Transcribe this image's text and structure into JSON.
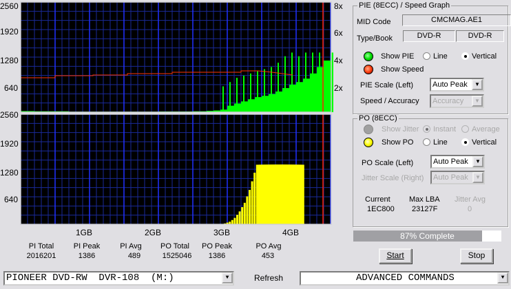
{
  "chart_data": [
    {
      "type": "bar",
      "title": "PIE (8ECC)",
      "series_color": "#00ff00",
      "ylim": [
        0,
        2560
      ],
      "yticks": [
        "2560",
        "1920",
        "1280",
        "640"
      ],
      "x_unit": "GB",
      "x_step": 0.1,
      "xlim": [
        0,
        4.4
      ],
      "xticks": [
        "1GB",
        "2GB",
        "3GB",
        "4GB"
      ],
      "values": [
        25,
        25,
        20,
        20,
        20,
        20,
        20,
        10,
        10,
        10,
        10,
        10,
        10,
        10,
        10,
        10,
        10,
        10,
        10,
        10,
        15,
        15,
        15,
        15,
        15,
        20,
        20,
        30,
        40,
        60,
        150,
        200,
        250,
        300,
        350,
        380,
        420,
        480,
        560,
        640,
        700,
        780,
        900,
        1050,
        1200,
        1386,
        1386,
        1386,
        1386,
        1386,
        1386,
        1386,
        1386,
        1386,
        1386,
        1386,
        1386,
        1386
      ],
      "peaks": [
        [
          29,
          600
        ],
        [
          30,
          700
        ],
        [
          31,
          800
        ],
        [
          32,
          850
        ],
        [
          33,
          900
        ],
        [
          34,
          950
        ],
        [
          35,
          1000
        ],
        [
          36,
          1050
        ],
        [
          37,
          1150
        ],
        [
          38,
          1300
        ],
        [
          39,
          1386
        ],
        [
          40,
          1300
        ],
        [
          41,
          1386
        ],
        [
          42,
          1386
        ],
        [
          43,
          1386
        ]
      ],
      "speed": {
        "color": "#ff3300",
        "yticks": [
          "8x",
          "6x",
          "4x",
          "2x"
        ],
        "ylim": [
          0,
          8
        ],
        "x": [
          0,
          0.5,
          0.5,
          1.05,
          1.05,
          1.55,
          1.55,
          2.2,
          2.2,
          3.2,
          3.2,
          3.45,
          3.65,
          3.8,
          3.95
        ],
        "y": [
          2.5,
          2.5,
          2.65,
          2.65,
          2.7,
          2.7,
          2.8,
          2.8,
          2.9,
          2.9,
          3.0,
          3.0,
          2.9,
          2.8,
          2.7
        ]
      },
      "end_marker_gb": 4.39
    },
    {
      "type": "bar",
      "title": "PO (8ECC)",
      "series_color": "#ffff00",
      "ylim": [
        0,
        2560
      ],
      "yticks": [
        "2560",
        "1920",
        "1280",
        "640"
      ],
      "x_unit": "GB",
      "x_step": 0.1,
      "xlim": [
        0,
        4.4
      ],
      "xticks": [
        "1GB",
        "2GB",
        "3GB",
        "4GB"
      ],
      "values": [
        0,
        0,
        0,
        0,
        0,
        5,
        0,
        0,
        0,
        0,
        0,
        0,
        0,
        0,
        0,
        0,
        0,
        0,
        0,
        0,
        0,
        0,
        0,
        0,
        0,
        0,
        0,
        0,
        0,
        0,
        0,
        0,
        0,
        0,
        0,
        0,
        0,
        0,
        0,
        0,
        0,
        0,
        0,
        0,
        0,
        0,
        0,
        0,
        0,
        0,
        0,
        0,
        0,
        0,
        0,
        0,
        0,
        0
      ],
      "values_fine": [
        20,
        40,
        60,
        100,
        150,
        220,
        300,
        400,
        500,
        650,
        800,
        1000,
        1200,
        1386,
        1386,
        1386,
        1386,
        1386,
        1386,
        1386,
        1386,
        1386
      ],
      "fine_start_gb": 3.55,
      "end_marker_gb": 4.39
    }
  ],
  "stats": {
    "pi_total_label": "PI Total",
    "pi_total": "2016201",
    "pi_peak_label": "PI Peak",
    "pi_peak": "1386",
    "pi_avg_label": "PI Avg",
    "pi_avg": "489",
    "po_total_label": "PO Total",
    "po_total": "1525046",
    "po_peak_label": "PO Peak",
    "po_peak": "1386",
    "po_avg_label": "PO Avg",
    "po_avg": "453"
  },
  "pie": {
    "title": "PIE (8ECC) / Speed Graph",
    "mid_label": "MID Code",
    "mid": "CMCMAG.AE1",
    "type_label": "Type/Book",
    "type": "DVD-R",
    "book": "DVD-R",
    "show_pie": "Show PIE",
    "line": "Line",
    "vertical": "Vertical",
    "show_speed": "Show Speed",
    "scale_label": "PIE Scale (Left)",
    "scale": "Auto Peak",
    "speed_label": "Speed / Accuracy",
    "speed_value": "Accuracy",
    "pie_color": "#00e000",
    "speed_color": "#ff4010"
  },
  "po": {
    "title": "PO (8ECC)",
    "show_jitter": "Show Jitter",
    "instant": "Instant",
    "average": "Average",
    "show_po": "Show PO",
    "line": "Line",
    "vertical": "Vertical",
    "scale_label": "PO Scale (Left)",
    "scale": "Auto Peak",
    "jitter_label": "Jitter Scale (Right)",
    "jitter_scale": "Auto Peak",
    "current_label": "Current",
    "current": "1EC800",
    "maxlba_label": "Max LBA",
    "maxlba": "23127F",
    "jitter_avg_label": "Jitter Avg",
    "jitter_avg": "0",
    "po_color": "#ffff00"
  },
  "progress": {
    "label": "87% Complete",
    "value": 0.87
  },
  "buttons": {
    "start": "Start",
    "stop": "Stop",
    "refresh": "Refresh"
  },
  "drive": "PIONEER DVD-RW  DVR-108  (M:)",
  "advanced": "ADVANCED COMMANDS"
}
